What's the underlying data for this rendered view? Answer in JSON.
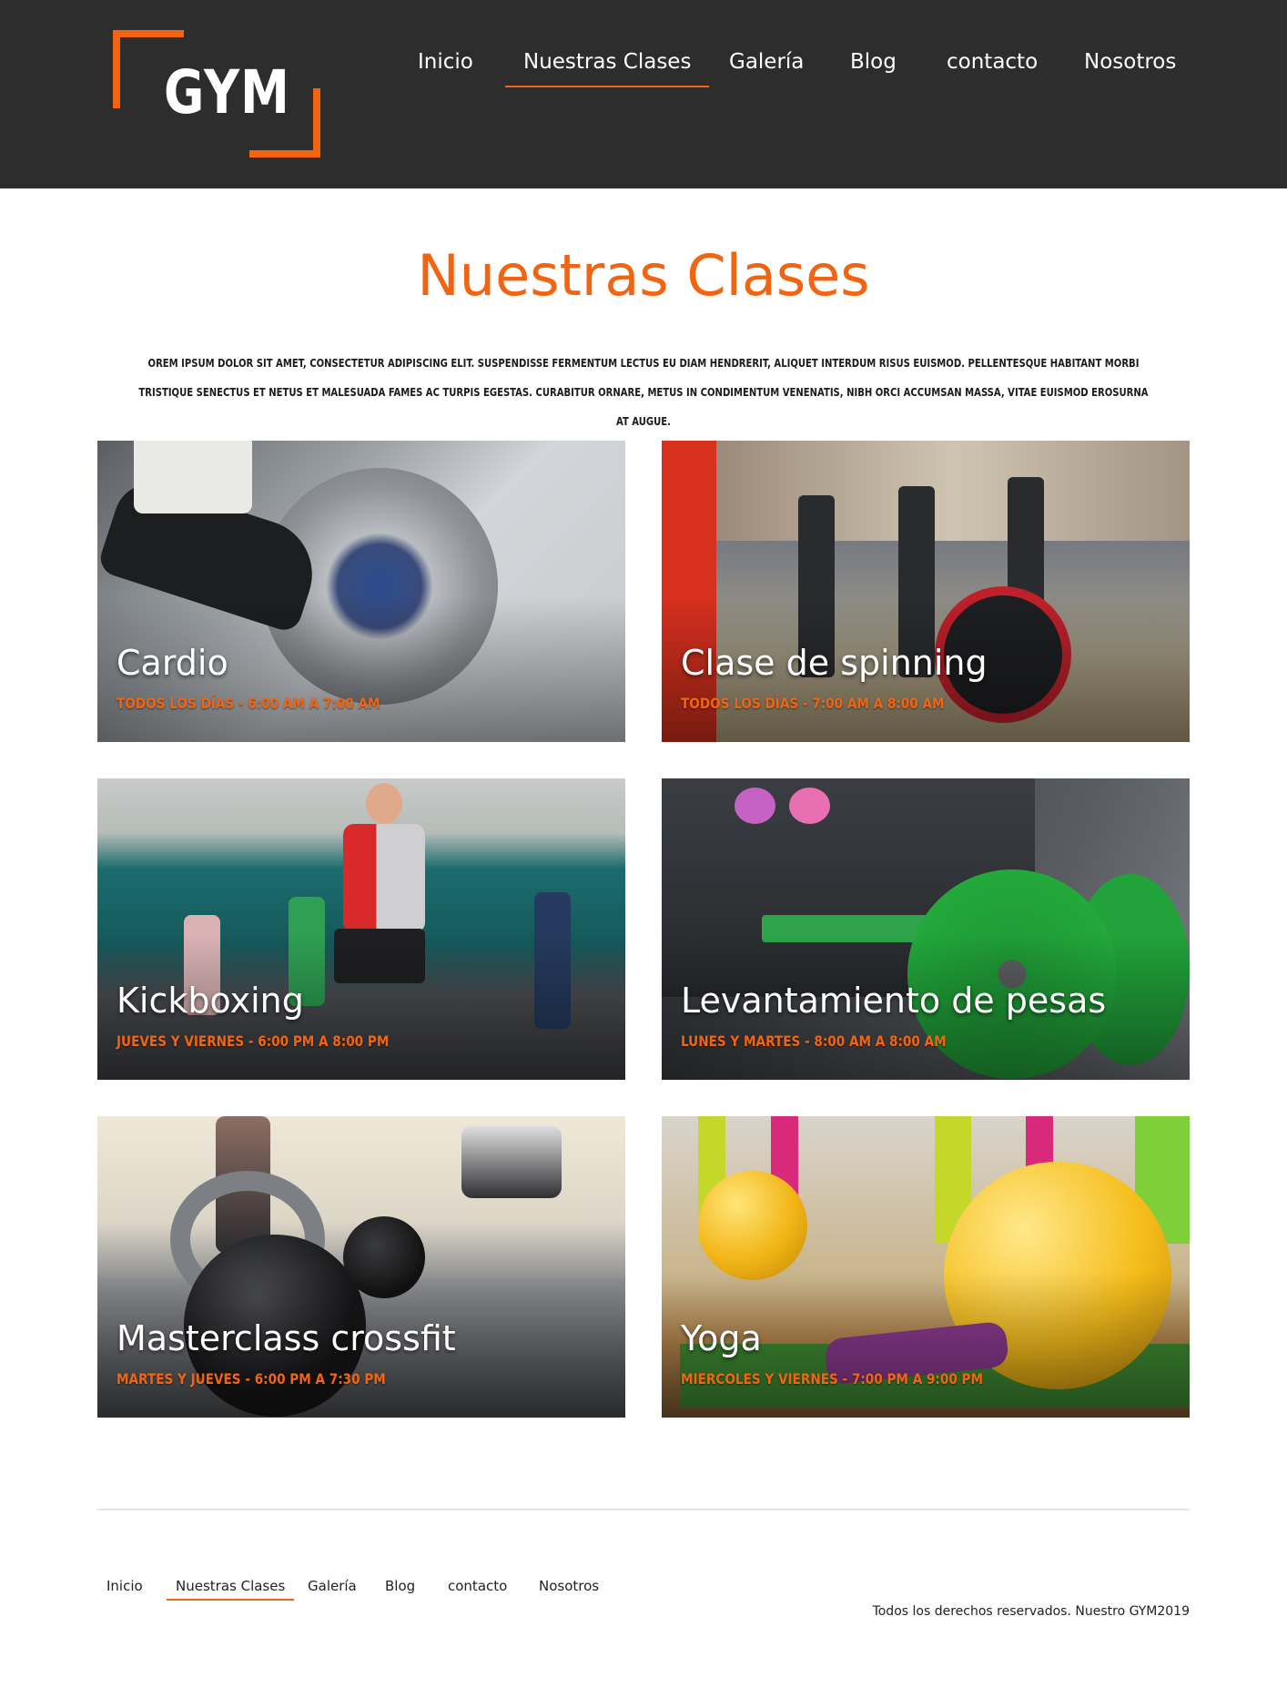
{
  "brand": {
    "logo_text": "GYM",
    "accent_color": "#f26411",
    "header_bg": "#2d2d2d"
  },
  "nav": {
    "items": [
      "Inicio",
      "Nuestras Clases",
      "Galería",
      "Blog",
      "contacto",
      "Nosotros"
    ],
    "active": "Nuestras Clases"
  },
  "page": {
    "title": "Nuestras Clases",
    "intro": "orem ipsum dolor sit amet, consectetur adipiscing elit. Suspendisse fermentum lectus eu diam hendrerit, aliquet interdum risus euismod. Pellentesque habitant morbi tristique senectus et netus et malesuada fames ac turpis egestas. Curabitur ornare, metus in condimentum venenatis, nibh orci accumsan massa, vitae euismod erosurna at augue."
  },
  "classes": [
    {
      "name": "Cardio",
      "schedule": "Todos los días - 6:00 AM a 7:00 AM"
    },
    {
      "name": "Clase de spinning",
      "schedule": "Todos los días - 7:00 AM a 8:00 AM"
    },
    {
      "name": "Kickboxing",
      "schedule": "Jueves y Viernes - 6:00 PM a 8:00 PM"
    },
    {
      "name": "Levantamiento de pesas",
      "schedule": "Lunes y Martes - 8:00 AM a 8:00 AM"
    },
    {
      "name": "Masterclass crossfit",
      "schedule": "Martes y Jueves - 6:00 PM a 7:30 PM"
    },
    {
      "name": "Yoga",
      "schedule": "Miercoles y Viernes - 7:00 PM a 9:00 PM"
    }
  ],
  "footer": {
    "nav": [
      "Inicio",
      "Nuestras Clases",
      "Galería",
      "Blog",
      "contacto",
      "Nosotros"
    ],
    "copyright": "Todos los derechos reservados. Nuestro GYM2019"
  }
}
